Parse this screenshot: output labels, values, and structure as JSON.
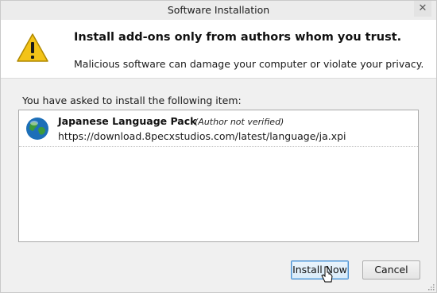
{
  "window": {
    "title": "Software Installation",
    "close_label": "✕"
  },
  "header": {
    "headline": "Install add-ons only from authors whom you trust.",
    "subline": "Malicious software can damage your computer or violate your privacy.",
    "icon": "warning-triangle-icon"
  },
  "main": {
    "prompt": "You have asked to install the following item:",
    "items": [
      {
        "name": "Japanese Language Pack",
        "note": "(Author not verified)",
        "url": "https://download.8pecxstudios.com/latest/language/ja.xpi",
        "icon": "globe-icon"
      }
    ]
  },
  "buttons": {
    "install_label": "Install Now",
    "cancel_label": "Cancel"
  },
  "colors": {
    "warning_yellow": "#f3c318",
    "focus_blue": "#4d90d0",
    "globe_blue": "#1d6fb8",
    "globe_green": "#3c9a3a"
  }
}
